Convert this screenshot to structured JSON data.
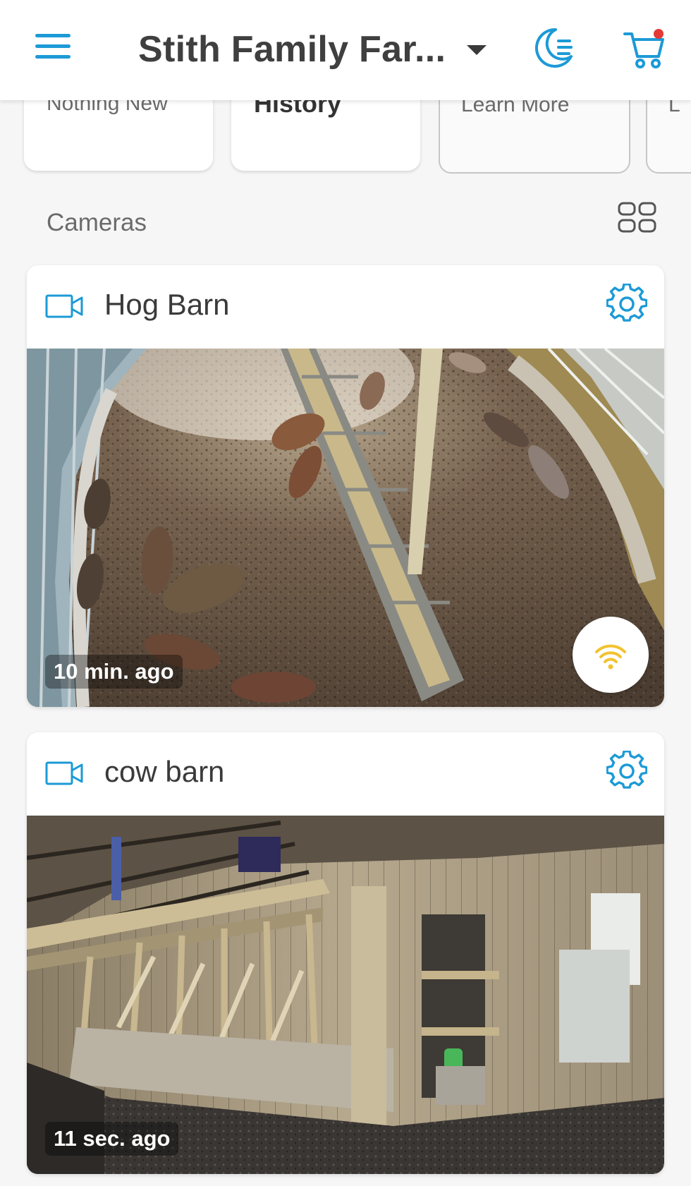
{
  "header": {
    "location_name": "Stith Family Far...",
    "cart_badge_color": "#e53935",
    "accent_color": "#1c9ad6"
  },
  "status_tiles": [
    {
      "label": "Nothing New"
    },
    {
      "label": "History"
    },
    {
      "label": "Learn More"
    },
    {
      "label": "L"
    }
  ],
  "cameras_section": {
    "title": "Cameras",
    "layout_toggle_icon": "grid-icon"
  },
  "cameras": [
    {
      "name": "Hog Barn",
      "last_update": "10 min. ago",
      "signal_icon": "wifi-icon",
      "signal_color": "#f2c230"
    },
    {
      "name": "cow barn",
      "last_update": "11 sec. ago"
    }
  ]
}
